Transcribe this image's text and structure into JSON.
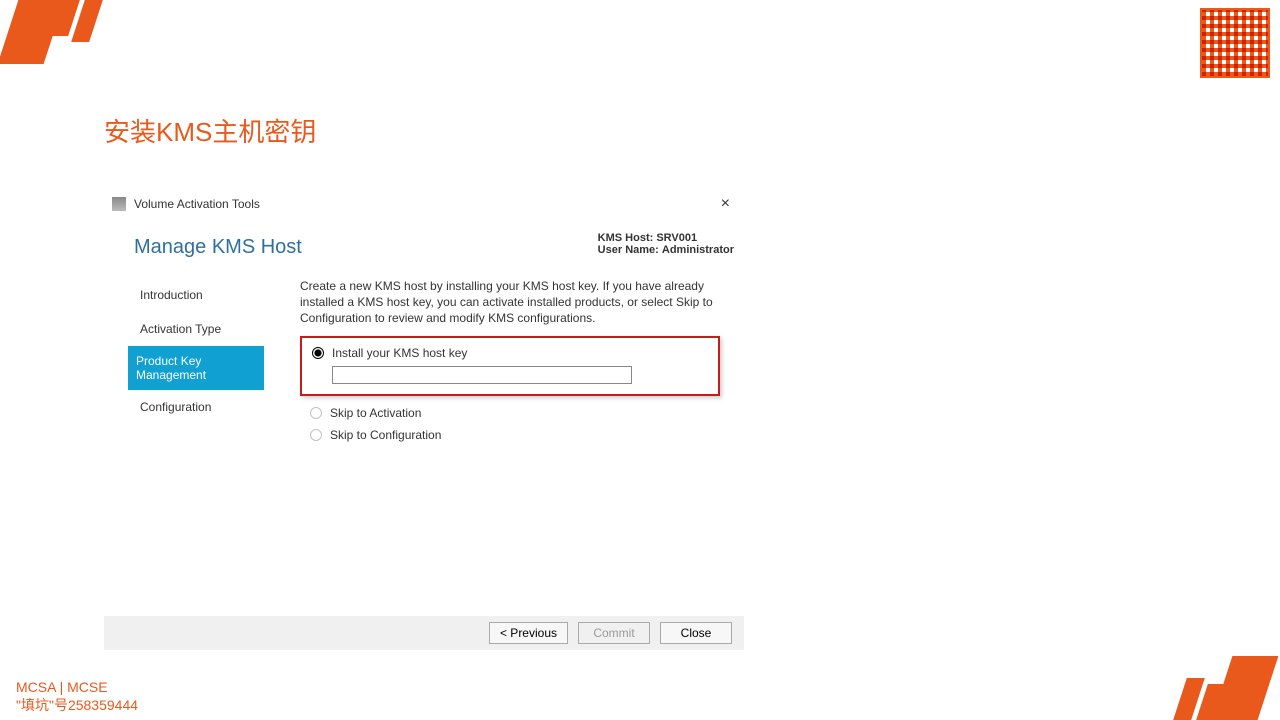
{
  "slide": {
    "title": "安装KMS主机密钥",
    "footer_line1": "MCSA | MCSE",
    "footer_line2": "\"填坑\"号258359444"
  },
  "wizard": {
    "window_title": "Volume Activation Tools",
    "heading": "Manage KMS Host",
    "host_label": "KMS Host:",
    "host_value": "SRV001",
    "user_label": "User Name:",
    "user_value": "Administrator",
    "steps": {
      "introduction": "Introduction",
      "activation_type": "Activation Type",
      "product_key_mgmt": "Product Key Management",
      "configuration": "Configuration"
    },
    "description": "Create a new KMS host by installing your KMS host key. If you have already installed a KMS host key, you can activate installed products, or select Skip to Configuration to review and modify KMS configurations.",
    "options": {
      "install_key": "Install your KMS host key",
      "skip_activation": "Skip to Activation",
      "skip_configuration": "Skip to Configuration"
    },
    "key_input_value": "",
    "buttons": {
      "previous": "<  Previous",
      "commit": "Commit",
      "close": "Close"
    }
  }
}
